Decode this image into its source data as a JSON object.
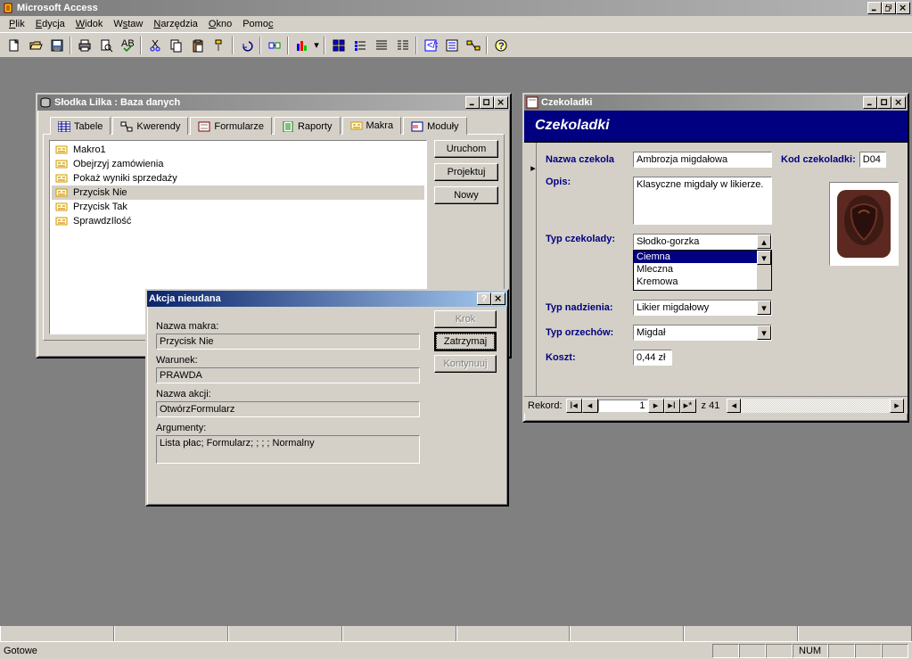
{
  "app": {
    "title": "Microsoft Access",
    "menus": [
      "Plik",
      "Edycja",
      "Widok",
      "Wstaw",
      "Narzędzia",
      "Okno",
      "Pomoc"
    ]
  },
  "db_window": {
    "title": "Słodka Lilka : Baza danych",
    "tabs": [
      "Tabele",
      "Kwerendy",
      "Formularze",
      "Raporty",
      "Makra",
      "Moduły"
    ],
    "active_tab": "Makra",
    "items": [
      "Makro1",
      "Obejrzyj zamówienia",
      "Pokaż wyniki sprzedaży",
      "Przycisk Nie",
      "Przycisk Tak",
      "SprawdzIlość"
    ],
    "selected": "Przycisk Nie",
    "buttons": {
      "run": "Uruchom",
      "design": "Projektuj",
      "new": "Nowy"
    }
  },
  "form_window": {
    "title": "Czekoladki",
    "header": "Czekoladki",
    "labels": {
      "name": "Nazwa czekola",
      "code": "Kod czekoladki:",
      "desc": "Opis:",
      "type": "Typ czekolady:",
      "filling": "Typ nadzienia:",
      "nuts": "Typ orzechów:",
      "cost": "Koszt:"
    },
    "values": {
      "name": "Ambrozja migdałowa",
      "code": "D04",
      "desc": "Klasyczne migdały w likierze.",
      "type_selected": "Słodko-gorzka",
      "type_options": [
        "Słodko-gorzka",
        "Ciemna",
        "Mleczna",
        "Kremowa"
      ],
      "type_highlighted": "Ciemna",
      "filling": "Likier migdałowy",
      "nuts": "Migdał",
      "cost": "0,44 zł"
    },
    "record_nav": {
      "label": "Rekord:",
      "current": "1",
      "total": "z 41"
    }
  },
  "dialog": {
    "title": "Akcja nieudana",
    "labels": {
      "macro_name": "Nazwa makra:",
      "condition": "Warunek:",
      "action_name": "Nazwa akcji:",
      "arguments": "Argumenty:"
    },
    "values": {
      "macro_name": "Przycisk Nie",
      "condition": "PRAWDA",
      "action_name": "OtwórzFormularz",
      "arguments": "Lista płac; Formularz; ; ; ; Normalny"
    },
    "buttons": {
      "step": "Krok",
      "halt": "Zatrzymaj",
      "continue": "Kontynuuj"
    }
  },
  "statusbar": {
    "text": "Gotowe",
    "num": "NUM"
  }
}
